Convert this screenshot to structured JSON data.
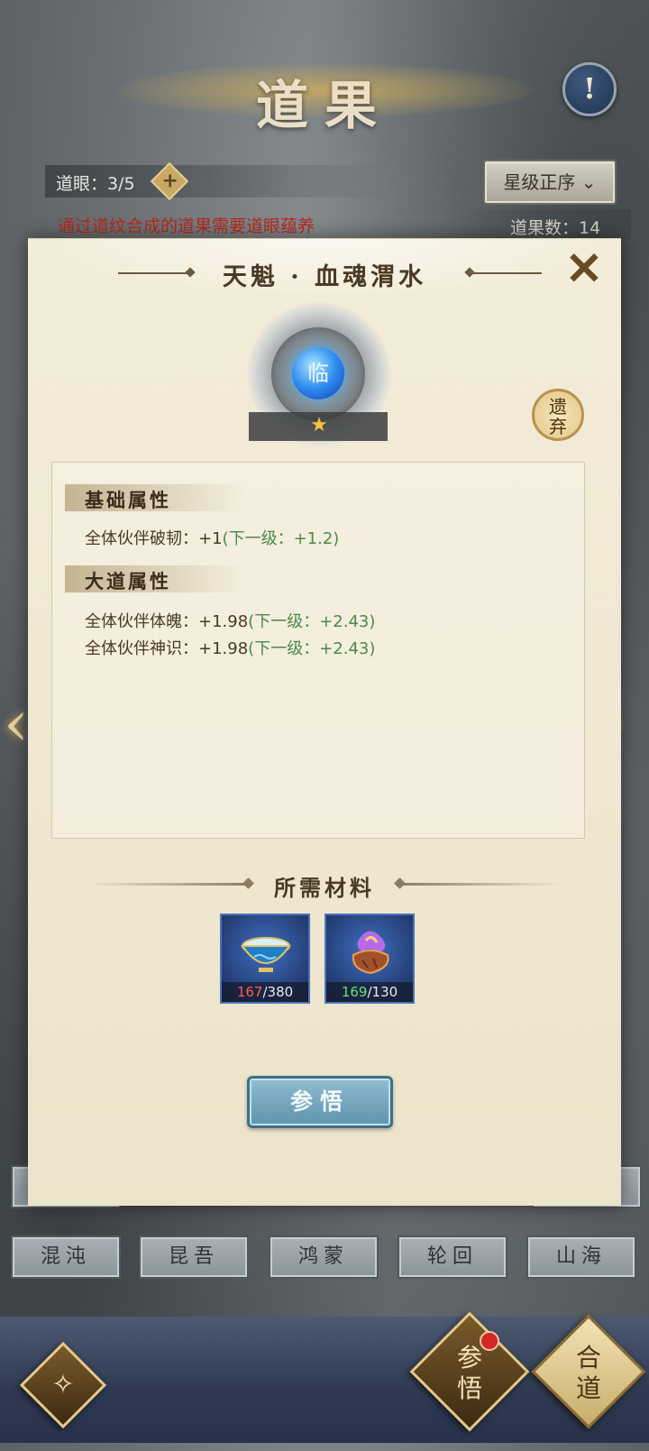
{
  "header": {
    "title": "道果",
    "info_icon": "!"
  },
  "status": {
    "eye_label": "道眼：3/5",
    "eye_add_icon": "+",
    "sort_label": "星级正序",
    "sort_icon": "⌄",
    "warning": "通过道纹合成的道果需要道眼蕴养",
    "count_label": "道果数：14"
  },
  "modal": {
    "title": "天魁 · 血魂渭水",
    "close_icon": "✕",
    "gem_glyph": "临",
    "star_icon": "★",
    "stars": 1,
    "discard_label": "遗弃",
    "basic": {
      "label": "基础属性",
      "lines": [
        {
          "text": "全体伙伴破韧：+1",
          "next": "(下一级：+1.2)"
        }
      ]
    },
    "dao": {
      "label": "大道属性",
      "lines": [
        {
          "text": "全体伙伴体魄：+1.98",
          "next": "(下一级：+2.43)"
        },
        {
          "text": "全体伙伴神识：+1.98",
          "next": "(下一级：+2.43)"
        }
      ]
    },
    "materials_title": "所需材料",
    "materials": [
      {
        "icon": "bowl-icon",
        "have": "167",
        "need": "/380",
        "enough": false
      },
      {
        "icon": "flame-stone-icon",
        "have": "169",
        "need": "/130",
        "enough": true
      }
    ],
    "action_label": "参悟"
  },
  "tabs_row2": [
    "混沌",
    "昆吾",
    "鸿蒙",
    "轮回",
    "山海"
  ],
  "bottom": {
    "comprehend_label": "参\n悟",
    "merge_label": "合\n道",
    "left_icon": "ornament-icon"
  },
  "colors": {
    "warning": "#b5291d",
    "next_level": "#4a8a4a",
    "material_low": "#ff5d4e",
    "material_ok": "#6ee07a"
  }
}
